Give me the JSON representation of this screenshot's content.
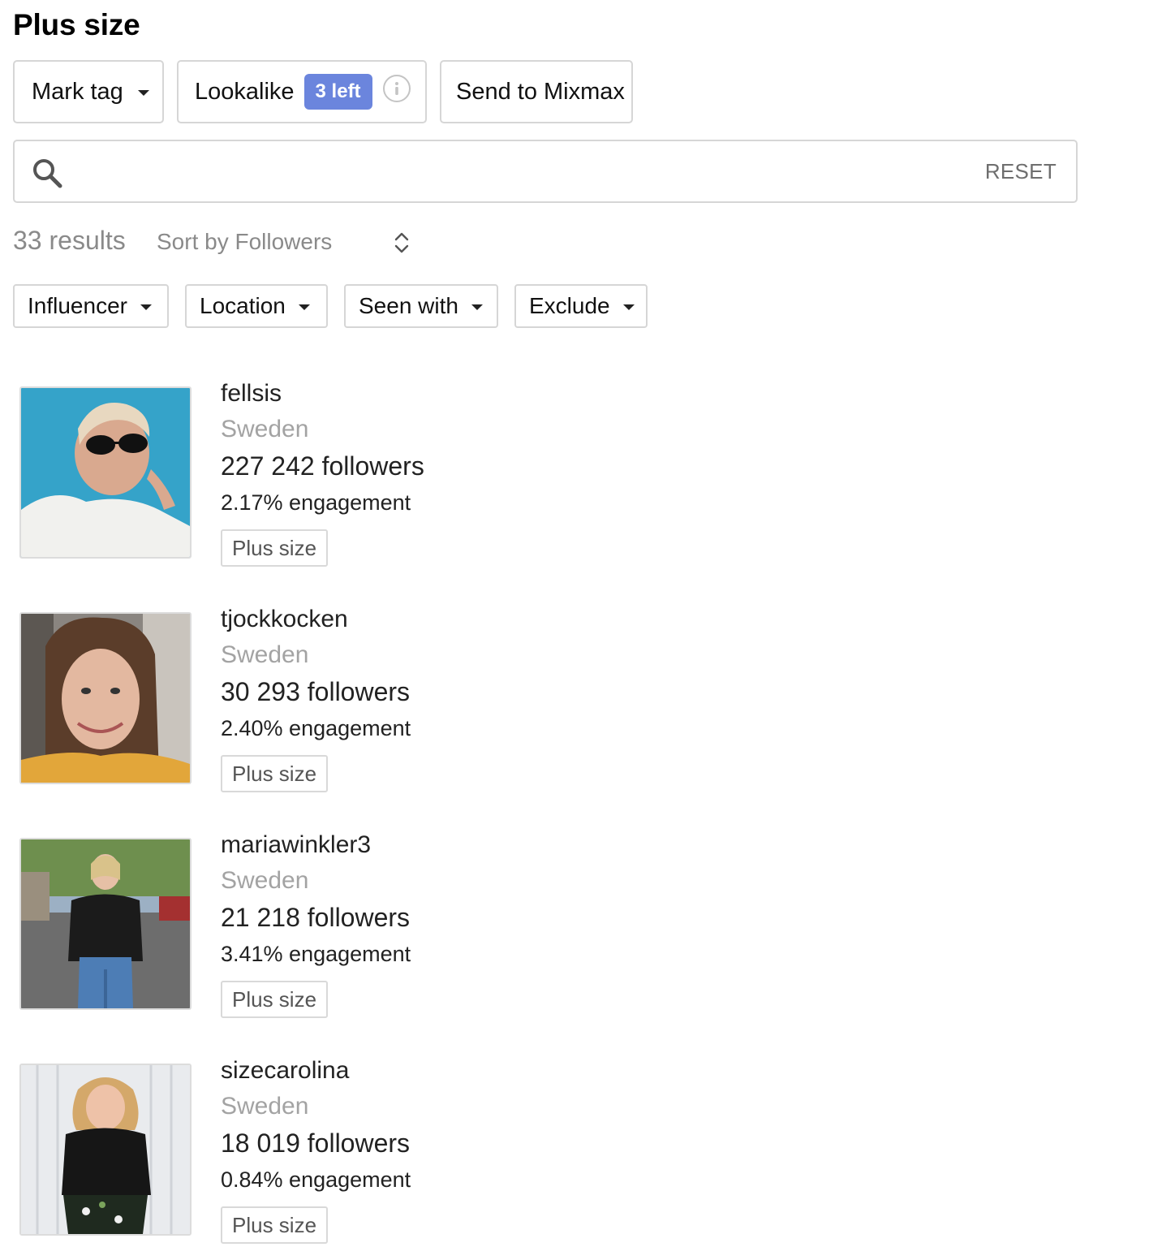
{
  "header": {
    "title": "Plus size"
  },
  "toolbar": {
    "mark_tag_label": "Mark tag",
    "lookalike_label": "Lookalike",
    "lookalike_badge": "3 left",
    "send_label": "Send to Mixmax"
  },
  "search": {
    "value": "",
    "placeholder": "",
    "reset_label": "RESET"
  },
  "results": {
    "count_label": "33 results",
    "sort_label": "Sort by Followers"
  },
  "filters": [
    {
      "label": "Influencer"
    },
    {
      "label": "Location"
    },
    {
      "label": "Seen with"
    },
    {
      "label": "Exclude"
    }
  ],
  "influencers": [
    {
      "username": "fellsis",
      "location": "Sweden",
      "followers": "227 242 followers",
      "engagement": "2.17% engagement",
      "tag": "Plus size"
    },
    {
      "username": "tjockkocken",
      "location": "Sweden",
      "followers": "30 293 followers",
      "engagement": "2.40% engagement",
      "tag": "Plus size"
    },
    {
      "username": "mariawinkler3",
      "location": "Sweden",
      "followers": "21 218 followers",
      "engagement": "3.41% engagement",
      "tag": "Plus size"
    },
    {
      "username": "sizecarolina",
      "location": "Sweden",
      "followers": "18 019 followers",
      "engagement": "0.84% engagement",
      "tag": "Plus size"
    }
  ],
  "colors": {
    "badge": "#6b85dd",
    "border": "#d6d6d6",
    "muted_text": "#8a8a8a"
  }
}
